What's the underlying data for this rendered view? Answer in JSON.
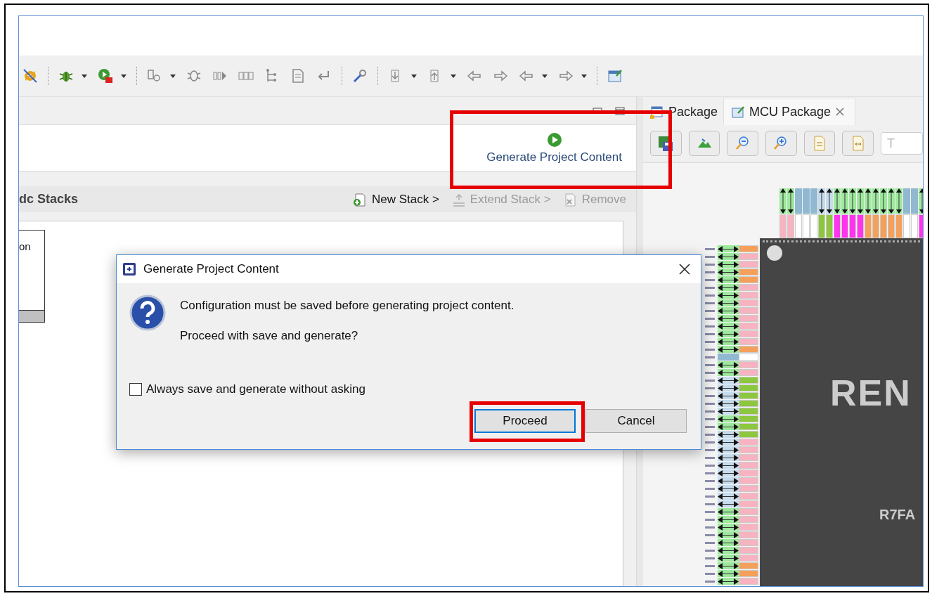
{
  "editor": {
    "generate_button": {
      "label": "Generate Project Content"
    },
    "stacks_title": "dc Stacks",
    "stack_actions": [
      {
        "label": "New Stack >",
        "disabled": false
      },
      {
        "label": "Extend Stack >",
        "disabled": true
      },
      {
        "label": "Remove",
        "disabled": true
      }
    ],
    "module_box": {
      "label": "on"
    }
  },
  "package_view": {
    "tabs": [
      {
        "label": "Package",
        "selected": false,
        "closable": false
      },
      {
        "label": "MCU Package",
        "selected": true,
        "closable": true
      }
    ],
    "filter_field": {
      "placeholder": "T"
    },
    "chip": {
      "logo": "REN",
      "part_number": "R7FA",
      "top_pins": [
        {
          "color": "#f7b3c0",
          "kind": "greenarrow"
        },
        {
          "color": "#f7b3c0",
          "kind": "greenarrow"
        },
        {
          "color": "#ffffff",
          "kind": "blocked"
        },
        {
          "color": "#ffffff",
          "kind": "blocked"
        },
        {
          "color": "#ffffff",
          "kind": "blocked"
        },
        {
          "color": "#8dc63f",
          "kind": "bluearrow"
        },
        {
          "color": "#8dc63f",
          "kind": "bluearrow"
        },
        {
          "color": "#ff33ee",
          "kind": "greenarrow"
        },
        {
          "color": "#ff33ee",
          "kind": "greenarrow"
        },
        {
          "color": "#ff33ee",
          "kind": "greenarrow"
        },
        {
          "color": "#ff33ee",
          "kind": "greenarrow"
        },
        {
          "color": "#f5a05a",
          "kind": "greenarrow"
        },
        {
          "color": "#f5a05a",
          "kind": "greenarrow"
        },
        {
          "color": "#f5a05a",
          "kind": "greenarrow"
        },
        {
          "color": "#f5a05a",
          "kind": "greenarrow"
        },
        {
          "color": "#f5a05a",
          "kind": "greenarrow"
        },
        {
          "color": "#ffffff",
          "kind": "blocked"
        },
        {
          "color": "#ffffff",
          "kind": "blocked"
        },
        {
          "color": "#ff33ee",
          "kind": "greenarrow"
        }
      ],
      "left_pins": [
        {
          "color": "#f5a05a",
          "kind": "greenarrow"
        },
        {
          "color": "#f7b3c0",
          "kind": "greenarrow"
        },
        {
          "color": "#f7b3c0",
          "kind": "greenarrow"
        },
        {
          "color": "#f5a05a",
          "kind": "greenarrow"
        },
        {
          "color": "#f5a05a",
          "kind": "greenarrow"
        },
        {
          "color": "#f7b3c0",
          "kind": "greenarrow"
        },
        {
          "color": "#f7b3c0",
          "kind": "greenarrow"
        },
        {
          "color": "#f7b3c0",
          "kind": "greenarrow"
        },
        {
          "color": "#f7b3c0",
          "kind": "greenarrow"
        },
        {
          "color": "#f7b3c0",
          "kind": "greenarrow"
        },
        {
          "color": "#f7b3c0",
          "kind": "greenarrow"
        },
        {
          "color": "#f7b3c0",
          "kind": "greenarrow"
        },
        {
          "color": "#f7b3c0",
          "kind": "greenarrow"
        },
        {
          "color": "#f5a05a",
          "kind": "greenarrow"
        },
        {
          "color": "#ffffff",
          "kind": "blocked"
        },
        {
          "color": "#f7b3c0",
          "kind": "greenarrow"
        },
        {
          "color": "#f7b3c0",
          "kind": "greenarrow"
        },
        {
          "color": "#8dc63f",
          "kind": "bluearrow"
        },
        {
          "color": "#8dc63f",
          "kind": "bluearrow"
        },
        {
          "color": "#8dc63f",
          "kind": "bluearrow"
        },
        {
          "color": "#8dc63f",
          "kind": "bluearrow"
        },
        {
          "color": "#8dc63f",
          "kind": "bluearrow"
        },
        {
          "color": "#8dc63f",
          "kind": "greenarrow"
        },
        {
          "color": "#8dc63f",
          "kind": "greenarrow"
        },
        {
          "color": "#8dc63f",
          "kind": "bluearrow"
        },
        {
          "color": "#f7b3c0",
          "kind": "bluearrow"
        },
        {
          "color": "#f7b3c0",
          "kind": "bluearrow"
        },
        {
          "color": "#f7b3c0",
          "kind": "bluearrow"
        },
        {
          "color": "#f7b3c0",
          "kind": "bluearrow"
        },
        {
          "color": "#f7b3c0",
          "kind": "bluearrow"
        },
        {
          "color": "#f7b3c0",
          "kind": "bluearrow"
        },
        {
          "color": "#f7b3c0",
          "kind": "bluearrow"
        },
        {
          "color": "#f7b3c0",
          "kind": "bluearrow"
        },
        {
          "color": "#f7b3c0",
          "kind": "bluearrow"
        },
        {
          "color": "#f7b3c0",
          "kind": "greenarrow"
        },
        {
          "color": "#f7b3c0",
          "kind": "greenarrow"
        },
        {
          "color": "#f7b3c0",
          "kind": "greenarrow"
        },
        {
          "color": "#f7b3c0",
          "kind": "greenarrow"
        },
        {
          "color": "#f7b3c0",
          "kind": "greenarrow"
        },
        {
          "color": "#f7b3c0",
          "kind": "greenarrow"
        },
        {
          "color": "#f7b3c0",
          "kind": "greenarrow"
        },
        {
          "color": "#f5a05a",
          "kind": "greenarrow"
        },
        {
          "color": "#f5a05a",
          "kind": "greenarrow"
        },
        {
          "color": "#f7b3c0",
          "kind": "greenarrow"
        }
      ]
    }
  },
  "dialog": {
    "title": "Generate Project Content",
    "message": "Configuration must be saved before generating project content.",
    "question": "Proceed with save and generate?",
    "checkbox": {
      "label": "Always save and generate without asking",
      "checked": false
    },
    "buttons": [
      {
        "label": "Proceed",
        "default": true
      },
      {
        "label": "Cancel",
        "default": false
      }
    ]
  }
}
